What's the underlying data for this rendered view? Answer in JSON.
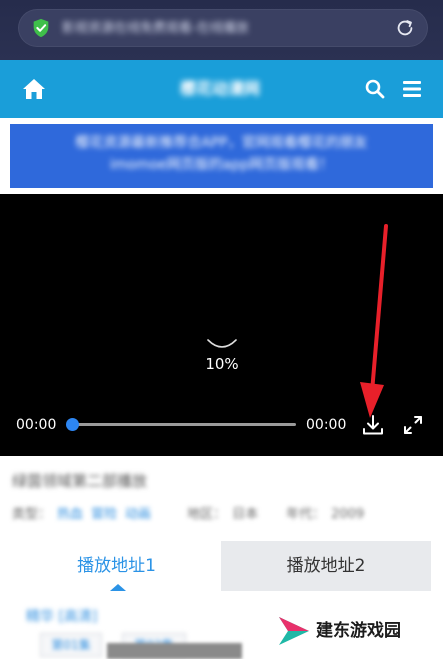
{
  "browser": {
    "url": "影视资源在线免费观看-在线播放",
    "icons": {
      "security": "shield-check-icon",
      "reload": "reload-icon"
    }
  },
  "header": {
    "title": "樱花动漫网",
    "icons": {
      "home": "home-icon",
      "search": "search-icon",
      "menu": "menu-icon"
    }
  },
  "notice": {
    "line1": "樱花资源最新推荐合APP，官网观看樱花的朋友",
    "line2": "imomoe网页版的app网页版观看！"
  },
  "player": {
    "loading_percent": "10%",
    "time_current": "00:00",
    "time_total": "00:00",
    "progress_fraction": 0,
    "icons": {
      "download": "download-icon",
      "fullscreen": "fullscreen-icon"
    }
  },
  "video": {
    "title": "绿茵领域第二部播放",
    "meta": {
      "type_label": "类型：",
      "tags": [
        "热血",
        "冒险",
        "动画"
      ],
      "region_label": "地区：",
      "region": "日本",
      "year_label": "年代：",
      "year": "2009"
    }
  },
  "tabs": [
    {
      "label": "播放地址1",
      "active": true
    },
    {
      "label": "播放地址2",
      "active": false
    }
  ],
  "episodes": {
    "label": "精华 [高清]",
    "chips": [
      "第01集",
      "第02集"
    ]
  },
  "watermark": {
    "text": "建东游戏园"
  },
  "colors": {
    "header": "#1a9ed9",
    "notice": "#2f69db",
    "accent": "#2b93e6",
    "annotation_arrow": "#e8202a"
  }
}
